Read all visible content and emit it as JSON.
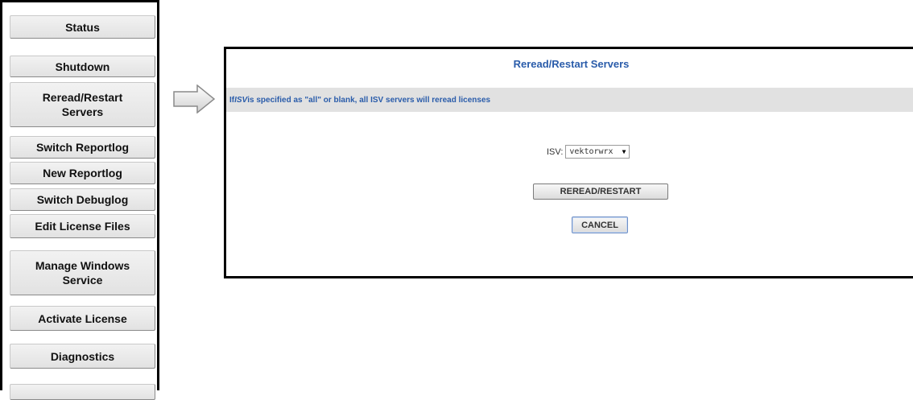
{
  "sidebar": {
    "items": [
      {
        "label": "Status"
      },
      {
        "label": "Shutdown"
      },
      {
        "label": "Reread/Restart\nServers"
      },
      {
        "label": "Switch Reportlog"
      },
      {
        "label": "New Reportlog"
      },
      {
        "label": "Switch Debuglog"
      },
      {
        "label": "Edit License Files"
      },
      {
        "label": "Manage Windows\nService"
      },
      {
        "label": "Activate License"
      },
      {
        "label": "Diagnostics"
      }
    ]
  },
  "panel": {
    "title": "Reread/Restart Servers",
    "info_prefix": "If ",
    "info_emph": "ISV",
    "info_suffix": " is specified as \"all\" or blank, all ISV servers will reread licenses",
    "isv_label": "ISV:",
    "isv_selected": "vektorwrx",
    "reread_button": "REREAD/RESTART",
    "cancel_button": "CANCEL"
  },
  "colors": {
    "title_blue": "#2a5caa",
    "info_bar_bg": "#e1e1e1"
  }
}
